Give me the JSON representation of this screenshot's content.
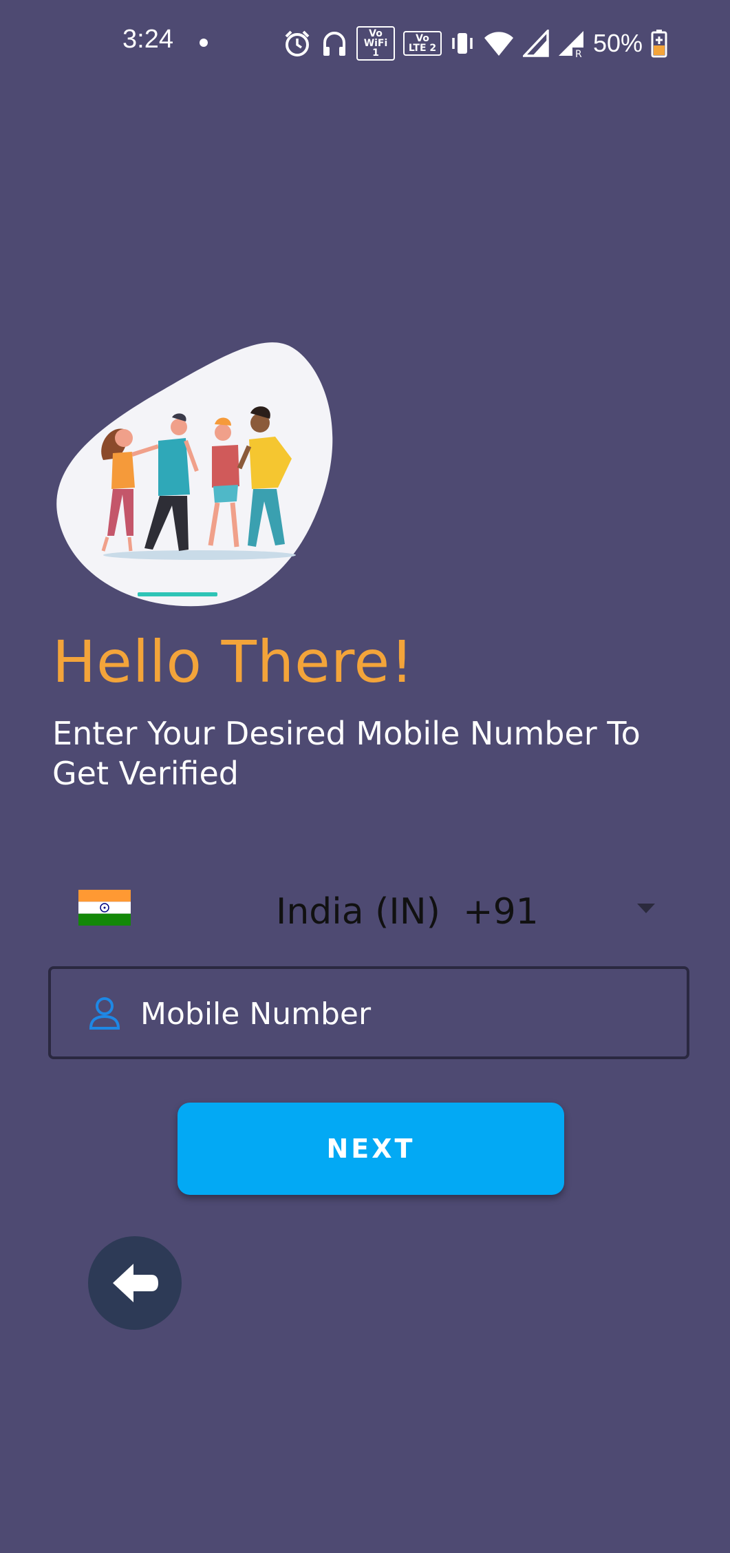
{
  "status_bar": {
    "time": "3:24",
    "battery": "50%",
    "icons": [
      "alarm-icon",
      "headphones-icon",
      "vowifi-icon",
      "volte-icon",
      "vibrate-icon",
      "wifi-icon",
      "signal-icon",
      "signal-roaming-icon",
      "battery-charging-icon"
    ],
    "vowifi_label": "Vo WiFi 1",
    "volte_label": "Vo LTE 2"
  },
  "hero": {
    "illustration": "group-of-friends-illustration",
    "colors": {
      "blob": "#f4f4f8",
      "accent": "#2ec4b6"
    }
  },
  "greeting": "Hello There!",
  "subtitle": "Enter Your Desired Mobile Number To Get Verified",
  "country_picker": {
    "flag": "india-flag-icon",
    "selected": "India (IN)  +91"
  },
  "mobile_field": {
    "placeholder": "Mobile Number",
    "value": ""
  },
  "next_button": {
    "label": "NEXT"
  },
  "colors": {
    "background": "#4e4a72",
    "greeting": "#f3a43a",
    "button": "#03a9f4",
    "back_button": "#2d3a56"
  }
}
